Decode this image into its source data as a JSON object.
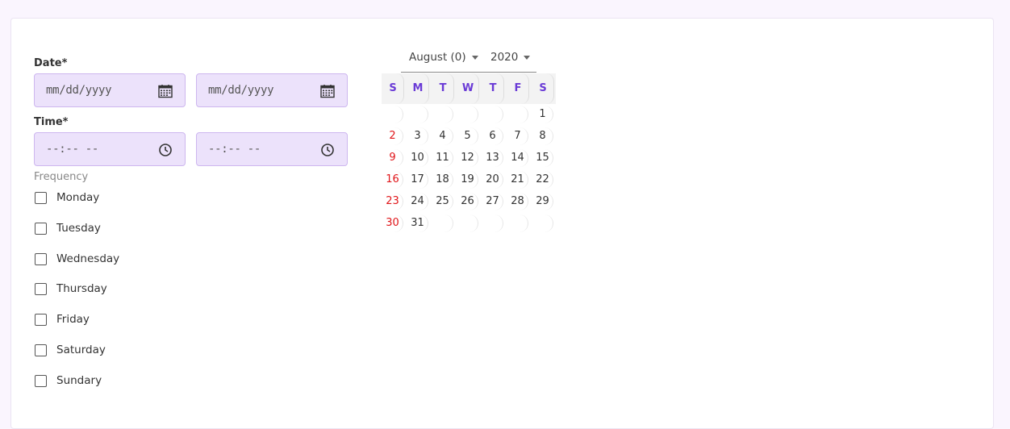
{
  "form": {
    "date_label": "Date*",
    "time_label": "Time*",
    "date_start_placeholder": "mm/dd/yyyy",
    "date_end_placeholder": "mm/dd/yyyy",
    "time_start_placeholder": "--:-- --",
    "time_end_placeholder": "--:-- --",
    "frequency_label": "Frequency",
    "days": [
      "Monday",
      "Tuesday",
      "Wednesday",
      "Thursday",
      "Friday",
      "Saturday",
      "Sundary"
    ]
  },
  "calendar": {
    "month_label": "August (0)",
    "year_label": "2020",
    "weekday_headers": [
      "S",
      "M",
      "T",
      "W",
      "T",
      "F",
      "S"
    ],
    "weeks": [
      [
        "",
        "",
        "",
        "",
        "",
        "",
        "1"
      ],
      [
        "2",
        "3",
        "4",
        "5",
        "6",
        "7",
        "8"
      ],
      [
        "9",
        "10",
        "11",
        "12",
        "13",
        "14",
        "15"
      ],
      [
        "16",
        "17",
        "18",
        "19",
        "20",
        "21",
        "22"
      ],
      [
        "23",
        "24",
        "25",
        "26",
        "27",
        "28",
        "29"
      ],
      [
        "30",
        "31",
        "",
        "",
        "",
        "",
        ""
      ]
    ]
  },
  "colors": {
    "accent": "#6a3bd6",
    "field_bg": "#ece2fb",
    "sunday": "#e0161a"
  }
}
